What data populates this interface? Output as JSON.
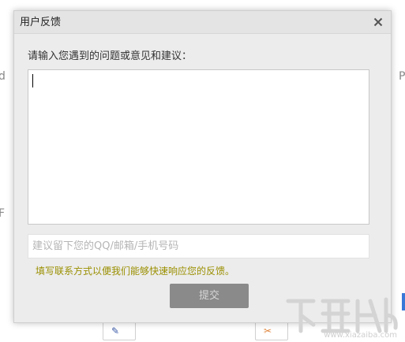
{
  "background": {
    "left_fragment_top": "d",
    "left_fragment_bottom": "F",
    "right_fragment_top": "P",
    "watermark_text": "www.xiazaiba.com"
  },
  "dialog": {
    "title": "用户反馈",
    "close_icon": "close-icon",
    "prompt_label": "请输入您遇到的问题或意见和建议：",
    "feedback_value": "",
    "contact_placeholder": "建议留下您的QQ/邮箱/手机号码",
    "contact_value": "",
    "hint": "填写联系方式以便我们能够快速响应您的反馈。",
    "submit_label": "提交"
  },
  "colors": {
    "hint_text": "#9a8f00",
    "submit_bg": "#8a8a8a",
    "dialog_bg": "#ececec"
  }
}
